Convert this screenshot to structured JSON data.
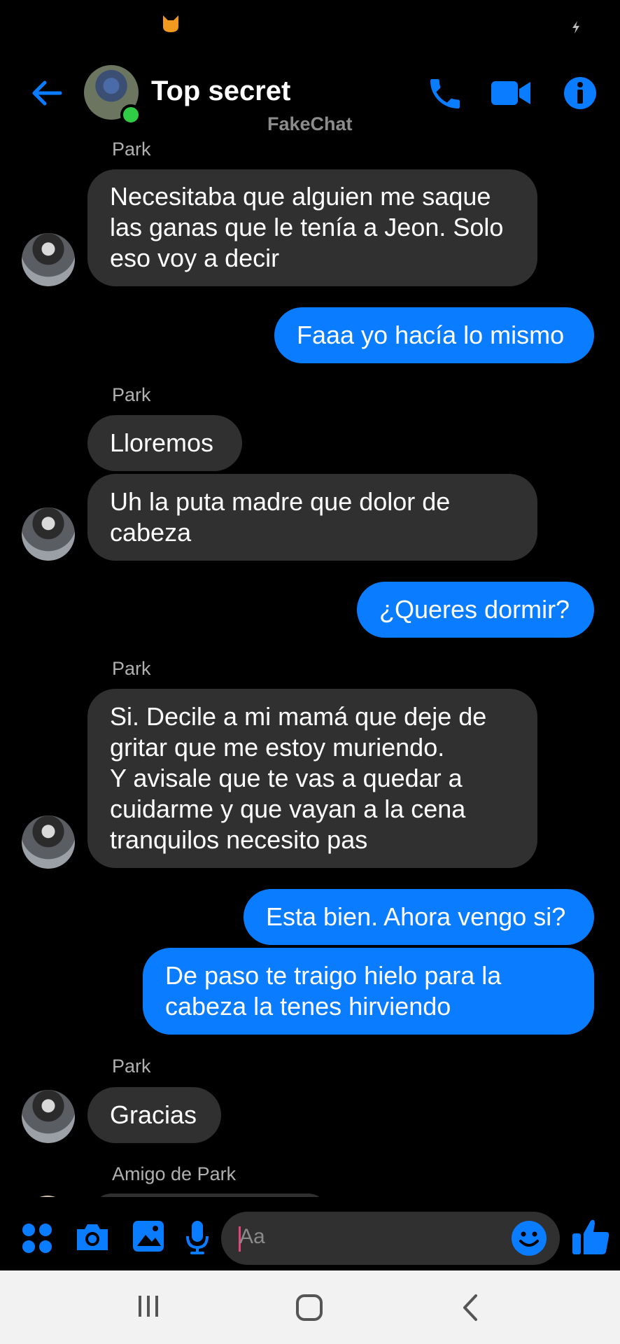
{
  "app": {
    "title": "Top secret",
    "watermark": "FakeChat",
    "accent_color": "#0a7cff",
    "incoming_bubble_color": "#303030",
    "online_status_color": "#31cc46"
  },
  "header": {
    "back_icon": "arrow-left-icon",
    "call_icon": "phone-icon",
    "video_icon": "video-camera-icon",
    "info_icon": "info-icon"
  },
  "messages": [
    {
      "type": "sender",
      "text": "Park"
    },
    {
      "type": "in",
      "text": "Necesitaba que alguien me saque\nlas ganas que le tenía a Jeon. Solo\neso voy a decir"
    },
    {
      "type": "out",
      "text": "Faaa yo hacía lo mismo"
    },
    {
      "type": "sender",
      "text": "Park"
    },
    {
      "type": "in",
      "text": "Lloremos"
    },
    {
      "type": "in",
      "text": "Uh la puta madre que dolor de\ncabeza"
    },
    {
      "type": "out",
      "text": "¿Queres dormir?"
    },
    {
      "type": "sender",
      "text": "Park"
    },
    {
      "type": "in",
      "text": "Si. Decile a mi mamá que deje de\ngritar que me estoy muriendo.\nY avisale que te vas a quedar a\ncuidarme y que vayan a la cena\ntranquilos necesito pas"
    },
    {
      "type": "out",
      "text": "Esta bien. Ahora vengo si?"
    },
    {
      "type": "out",
      "text": "De paso te traigo hielo para la\ncabeza la tenes hirviendo"
    },
    {
      "type": "sender",
      "text": "Park"
    },
    {
      "type": "in",
      "text": "Gracias"
    },
    {
      "type": "sender",
      "text": "Amigo de Park"
    }
  ],
  "composer": {
    "placeholder": "Aa",
    "icons": [
      "apps-grid-icon",
      "camera-icon",
      "gallery-icon",
      "microphone-icon",
      "emoji-icon",
      "thumbs-up-icon"
    ]
  },
  "navbar": {
    "icons": [
      "recent-apps-icon",
      "home-icon",
      "nav-back-icon"
    ]
  }
}
